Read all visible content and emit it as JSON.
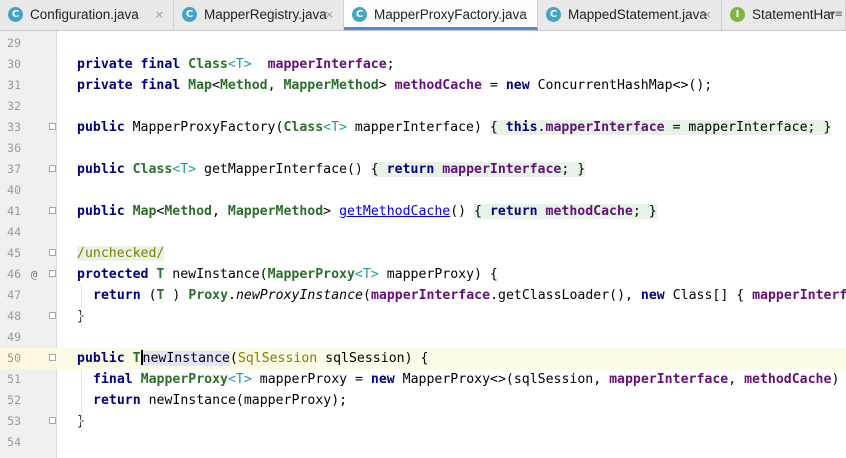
{
  "tabs": [
    {
      "icon": "C",
      "label": "Configuration.java",
      "active": false
    },
    {
      "icon": "C",
      "label": "MapperRegistry.java",
      "active": false
    },
    {
      "icon": "C",
      "label": "MapperProxyFactory.java",
      "active": true
    },
    {
      "icon": "C",
      "label": "MappedStatement.java",
      "active": false
    },
    {
      "icon": "I",
      "label": "StatementHar",
      "active": false
    }
  ],
  "tab_close_glyph": "×",
  "tab_overflow_glyph": "▾≡",
  "colors": {
    "keyword": "#000080",
    "type": "#2b6f2b",
    "field": "#660e7a",
    "generic": "#20999d",
    "link": "#0000ee",
    "annotation": "#808000",
    "current_line": "#fcfbe6"
  },
  "editor": {
    "lines": [
      {
        "n": "29",
        "segs": []
      },
      {
        "n": "30",
        "segs": [
          [
            "kw",
            "private final "
          ],
          [
            "ty",
            "Class"
          ],
          [
            "gen",
            "<T>"
          ],
          [
            "",
            "  "
          ],
          [
            "fld",
            "mapperInterface"
          ],
          [
            "",
            ";"
          ]
        ]
      },
      {
        "n": "31",
        "segs": [
          [
            "kw",
            "private final "
          ],
          [
            "ty",
            "Map"
          ],
          [
            "",
            "<"
          ],
          [
            "ty",
            "Method"
          ],
          [
            "",
            ", "
          ],
          [
            "ty",
            "MapperMethod"
          ],
          [
            "",
            "> "
          ],
          [
            "fld",
            "methodCache"
          ],
          [
            "",
            " = "
          ],
          [
            "kw",
            "new "
          ],
          [
            "",
            "ConcurrentHashMap<>();"
          ]
        ]
      },
      {
        "n": "32",
        "segs": []
      },
      {
        "n": "33",
        "fold": true,
        "segs": [
          [
            "kw",
            "public "
          ],
          [
            "",
            "MapperProxyFactory("
          ],
          [
            "ty",
            "Class"
          ],
          [
            "gen",
            "<T>"
          ],
          [
            "",
            " mapperInterface) "
          ],
          [
            "fb",
            "{ "
          ],
          [
            "kw fb",
            "this"
          ],
          [
            "fb",
            "."
          ],
          [
            "fld fb",
            "mapperInterface"
          ],
          [
            "fb",
            " = mapperInterface; }"
          ]
        ]
      },
      {
        "n": "36",
        "segs": []
      },
      {
        "n": "37",
        "fold": true,
        "segs": [
          [
            "kw",
            "public "
          ],
          [
            "ty",
            "Class"
          ],
          [
            "gen",
            "<T>"
          ],
          [
            "",
            " getMapperInterface() "
          ],
          [
            "fb",
            "{ "
          ],
          [
            "kw fb",
            "return "
          ],
          [
            "fld fb",
            "mapperInterface"
          ],
          [
            "fb",
            "; }"
          ]
        ]
      },
      {
        "n": "40",
        "segs": []
      },
      {
        "n": "41",
        "fold": true,
        "segs": [
          [
            "kw",
            "public "
          ],
          [
            "ty",
            "Map"
          ],
          [
            "",
            "<"
          ],
          [
            "ty",
            "Method"
          ],
          [
            "",
            ", "
          ],
          [
            "ty",
            "MapperMethod"
          ],
          [
            "",
            "> "
          ],
          [
            "lnk",
            "getMethodCache"
          ],
          [
            "",
            "() "
          ],
          [
            "fb",
            "{ "
          ],
          [
            "kw fb",
            "return "
          ],
          [
            "fld fb",
            "methodCache"
          ],
          [
            "fb",
            "; }"
          ]
        ]
      },
      {
        "n": "44",
        "segs": []
      },
      {
        "n": "45",
        "fold": true,
        "segs": [
          [
            "ann fb",
            "/unchecked/"
          ]
        ]
      },
      {
        "n": "46",
        "marker": "@",
        "fold": true,
        "segs": [
          [
            "kw",
            "protected "
          ],
          [
            "ty",
            "T"
          ],
          [
            "",
            " newInstance("
          ],
          [
            "ty",
            "MapperProxy"
          ],
          [
            "gen",
            "<T>"
          ],
          [
            "",
            " mapperProxy) {"
          ]
        ]
      },
      {
        "n": "47",
        "indent": true,
        "segs": [
          [
            "kw",
            "return "
          ],
          [
            "",
            "("
          ],
          [
            "ty",
            "T"
          ],
          [
            "",
            " ) "
          ],
          [
            "ty",
            "Proxy"
          ],
          [
            "",
            "."
          ],
          [
            "it",
            "newProxyInstance"
          ],
          [
            "",
            "("
          ],
          [
            "fld",
            "mapperInterface"
          ],
          [
            "",
            ".getClassLoader(), "
          ],
          [
            "kw",
            "new "
          ],
          [
            "",
            "Class[] { "
          ],
          [
            "fld",
            "mapperInterfa"
          ]
        ]
      },
      {
        "n": "48",
        "fold": true,
        "segs": [
          [
            "",
            "}"
          ]
        ]
      },
      {
        "n": "49",
        "segs": []
      },
      {
        "n": "50",
        "current": true,
        "fold": true,
        "segs": [
          [
            "kw",
            "public "
          ],
          [
            "ty",
            "T"
          ],
          [
            "caret",
            ""
          ],
          [
            "hl",
            "newInstance"
          ],
          [
            "",
            "("
          ],
          [
            "ann",
            "SqlSession"
          ],
          [
            "",
            " sqlSession) {"
          ]
        ]
      },
      {
        "n": "51",
        "indent": true,
        "segs": [
          [
            "kw",
            "final "
          ],
          [
            "ty",
            "MapperProxy"
          ],
          [
            "gen",
            "<T>"
          ],
          [
            "",
            " mapperProxy = "
          ],
          [
            "kw",
            "new "
          ],
          [
            "",
            "MapperProxy<>(sqlSession, "
          ],
          [
            "fld",
            "mapperInterface"
          ],
          [
            "",
            ", "
          ],
          [
            "fld",
            "methodCache"
          ],
          [
            "",
            ")"
          ]
        ]
      },
      {
        "n": "52",
        "indent": true,
        "segs": [
          [
            "kw",
            "return "
          ],
          [
            "",
            "newInstance(mapperProxy);"
          ]
        ]
      },
      {
        "n": "53",
        "fold": true,
        "segs": [
          [
            "",
            "}"
          ]
        ]
      },
      {
        "n": "54",
        "segs": []
      }
    ]
  }
}
